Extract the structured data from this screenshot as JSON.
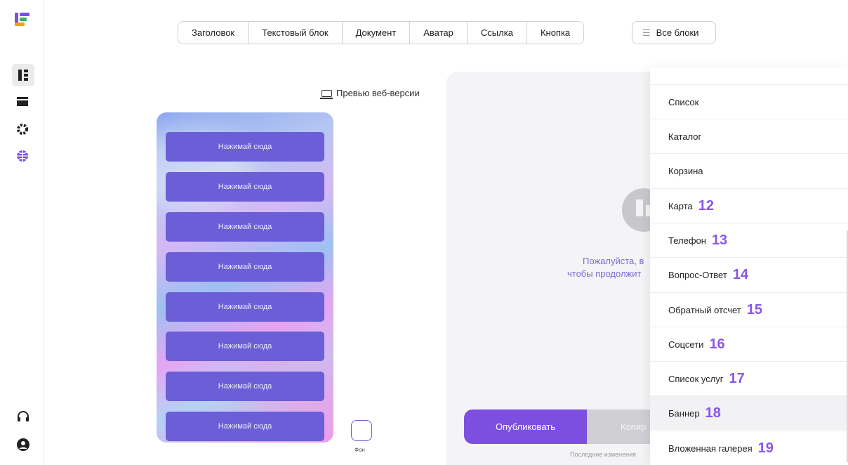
{
  "toolbar": {
    "items": [
      "Заголовок",
      "Текстовый блок",
      "Документ",
      "Аватар",
      "Ссылка",
      "Кнопка"
    ],
    "all_blocks": "Все блоки"
  },
  "preview": {
    "label": "Превью веб-версии",
    "button_label": "Нажимай сюда",
    "background_label": "Фон"
  },
  "panel": {
    "message_line1": "Пожалуйста, в",
    "message_line2": "чтобы продолжит",
    "publish": "Опубликовать",
    "copy": "Копир",
    "last_changes": "Последние изменения"
  },
  "dropdown": {
    "items": [
      {
        "label": "Список",
        "num": ""
      },
      {
        "label": "Каталог",
        "num": ""
      },
      {
        "label": "Корзина",
        "num": ""
      },
      {
        "label": "Карта",
        "num": "12"
      },
      {
        "label": "Телефон",
        "num": "13"
      },
      {
        "label": "Вопрос-Ответ",
        "num": "14"
      },
      {
        "label": "Обратный отсчет",
        "num": "15"
      },
      {
        "label": "Соцсети",
        "num": "16"
      },
      {
        "label": "Список услуг",
        "num": "17"
      },
      {
        "label": "Баннер",
        "num": "18"
      },
      {
        "label": "Вложенная галерея",
        "num": "19"
      }
    ]
  },
  "colors": {
    "accent": "#7d4fe0",
    "button": "#6b5ed6",
    "number": "#8a56e8"
  }
}
